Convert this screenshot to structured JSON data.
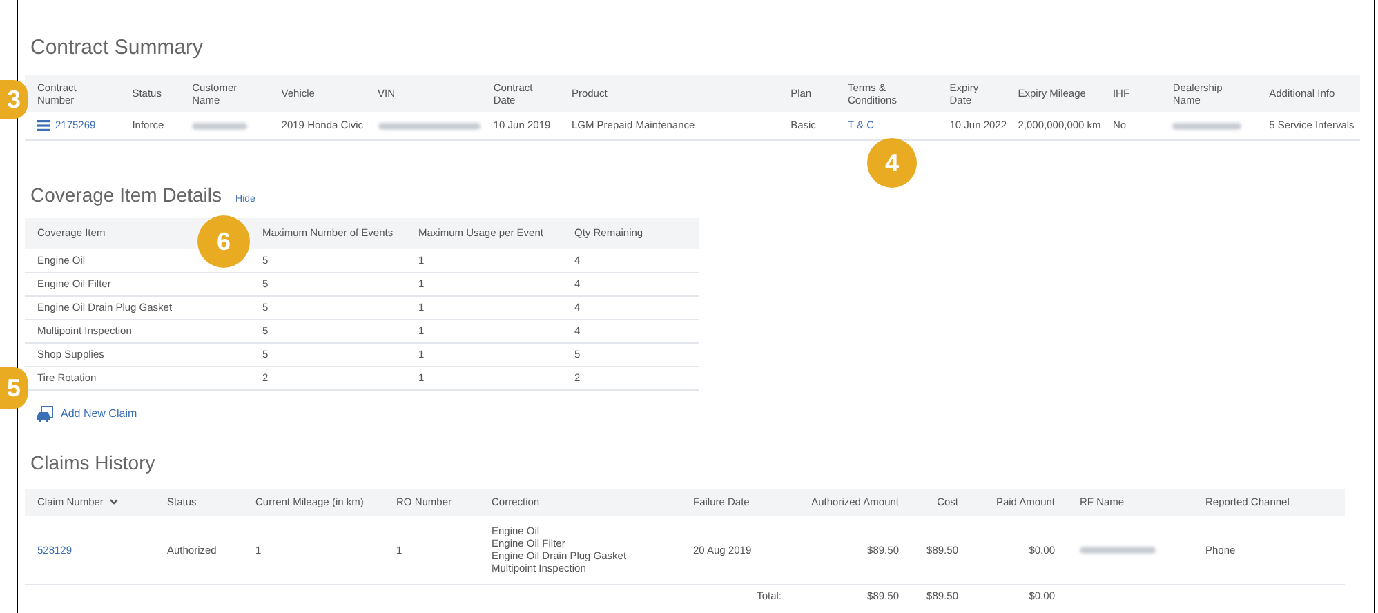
{
  "contract_summary": {
    "title": "Contract Summary",
    "columns": [
      "Contract Number",
      "Status",
      "Customer Name",
      "Vehicle",
      "VIN",
      "Contract Date",
      "Product",
      "Plan",
      "Terms & Conditions",
      "Expiry Date",
      "Expiry Mileage",
      "IHF",
      "Dealership Name",
      "Additional Info"
    ],
    "row": {
      "contract_number": "2175269",
      "status": "Inforce",
      "vehicle": "2019 Honda Civic",
      "contract_date": "10 Jun 2019",
      "product": "LGM Prepaid Maintenance",
      "plan": "Basic",
      "terms": "T & C",
      "expiry_date": "10 Jun 2022",
      "expiry_mileage": "2,000,000,000 km",
      "ihf": "No",
      "additional_info": "5 Service Intervals"
    }
  },
  "coverage": {
    "title": "Coverage Item Details",
    "hide_link": "Hide",
    "columns": [
      "Coverage Item",
      "Maximum Number of Events",
      "Maximum Usage per Event",
      "Qty Remaining"
    ],
    "rows": [
      [
        "Engine Oil",
        "5",
        "1",
        "4"
      ],
      [
        "Engine Oil Filter",
        "5",
        "1",
        "4"
      ],
      [
        "Engine Oil Drain Plug Gasket",
        "5",
        "1",
        "4"
      ],
      [
        "Multipoint Inspection",
        "5",
        "1",
        "4"
      ],
      [
        "Shop Supplies",
        "5",
        "1",
        "5"
      ],
      [
        "Tire Rotation",
        "2",
        "1",
        "2"
      ]
    ]
  },
  "add_claim": "Add New Claim",
  "claims": {
    "title": "Claims History",
    "columns": [
      "Claim Number",
      "Status",
      "Current Mileage (in km)",
      "RO Number",
      "Correction",
      "Failure Date",
      "Authorized Amount",
      "Cost",
      "Paid Amount",
      "RF Name",
      "Reported Channel"
    ],
    "rows": [
      {
        "claim_number": "528129",
        "status": "Authorized",
        "mileage": "1",
        "ro_number": "1",
        "correction": [
          "Engine Oil",
          "Engine Oil Filter",
          "Engine Oil Drain Plug Gasket",
          "Multipoint Inspection"
        ],
        "failure_date": "20 Aug 2019",
        "authorized_amount": "$89.50",
        "cost": "$89.50",
        "paid_amount": "$0.00",
        "reported_channel": "Phone"
      }
    ],
    "total": {
      "label": "Total:",
      "authorized_amount": "$89.50",
      "cost": "$89.50",
      "paid_amount": "$0.00"
    }
  },
  "callouts": [
    {
      "label": "3"
    },
    {
      "label": "4"
    },
    {
      "label": "5"
    },
    {
      "label": "6"
    }
  ]
}
